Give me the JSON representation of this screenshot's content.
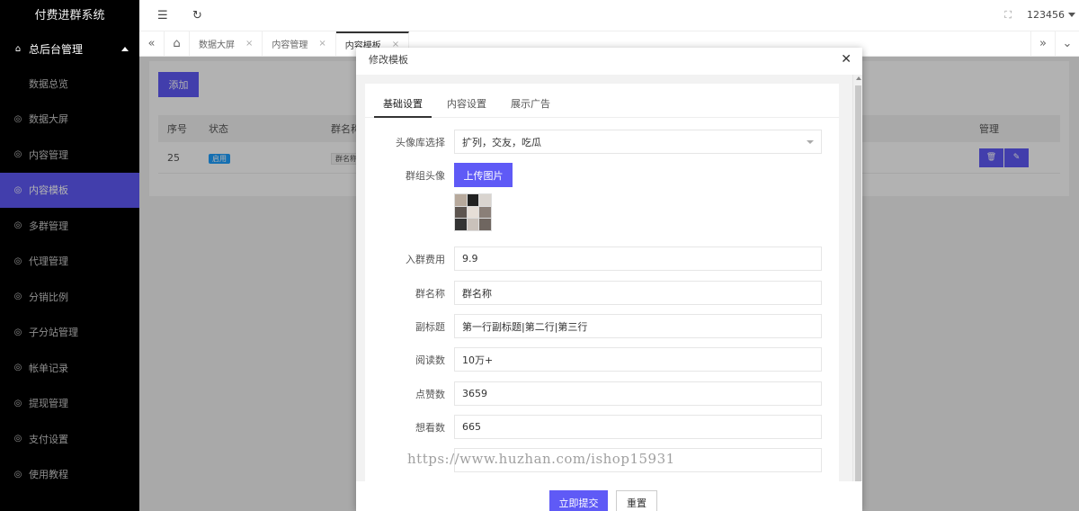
{
  "app": {
    "title": "付费进群系统"
  },
  "sidebar": {
    "group": "总后台管理",
    "items": [
      {
        "label": "数据总览"
      },
      {
        "label": "数据大屏"
      },
      {
        "label": "内容管理"
      },
      {
        "label": "内容模板"
      },
      {
        "label": "多群管理"
      },
      {
        "label": "代理管理"
      },
      {
        "label": "分销比例"
      },
      {
        "label": "子分站管理"
      },
      {
        "label": "帐单记录"
      },
      {
        "label": "提现管理"
      },
      {
        "label": "支付设置"
      },
      {
        "label": "使用教程"
      }
    ],
    "active_index": 3
  },
  "header": {
    "user": "123456"
  },
  "tabs": [
    {
      "label": "数据大屏"
    },
    {
      "label": "内容管理"
    },
    {
      "label": "内容模板"
    }
  ],
  "page": {
    "add_label": "添加",
    "columns": {
      "seq": "序号",
      "status": "状态",
      "name": "群名称",
      "manage": "管理"
    },
    "row": {
      "seq": "25",
      "status": "启用",
      "name": "群名称"
    }
  },
  "modal": {
    "title": "修改模板",
    "tabs": [
      "基础设置",
      "内容设置",
      "展示广告"
    ],
    "fields": {
      "avatar_lib": {
        "label": "头像库选择",
        "value": "扩列，交友，吃瓜"
      },
      "group_avatar": {
        "label": "群组头像",
        "button": "上传图片"
      },
      "fee": {
        "label": "入群费用",
        "value": "9.9"
      },
      "name": {
        "label": "群名称",
        "value": "群名称"
      },
      "subtitle": {
        "label": "副标题",
        "value": "第一行副标题|第二行|第三行"
      },
      "reads": {
        "label": "阅读数",
        "value": "10万+"
      },
      "likes": {
        "label": "点赞数",
        "value": "3659"
      },
      "wants": {
        "label": "想看数",
        "value": "665"
      }
    },
    "watermark": "https://www.huzhan.com/ishop15931",
    "submit_label": "立即提交",
    "reset_label": "重置"
  },
  "colors": {
    "accent": "#5f5af6",
    "sidebar_bg": "#000000",
    "tag_blue": "#1e9fff"
  }
}
